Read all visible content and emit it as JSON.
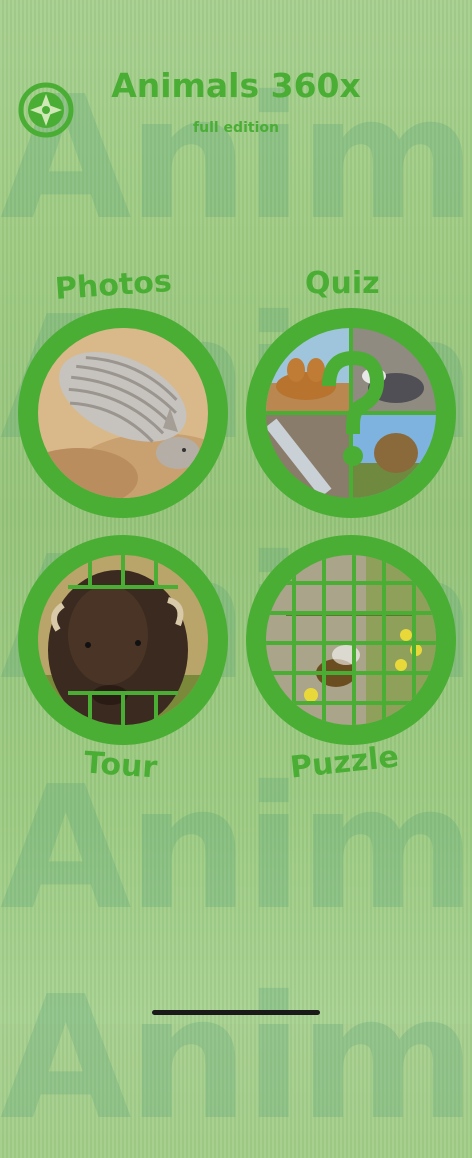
{
  "app": {
    "title": "Animals 360x",
    "subtitle": "full edition",
    "background_word": "Animals"
  },
  "menu": {
    "photos": {
      "label": "Photos"
    },
    "quiz": {
      "label": "Quiz"
    },
    "tour": {
      "label": "Tour"
    },
    "puzzle": {
      "label": "Puzzle"
    }
  },
  "icons": {
    "compass": "compass-icon"
  },
  "colors": {
    "accent_green": "#4aae34",
    "background_grass": "#9fcc84"
  }
}
